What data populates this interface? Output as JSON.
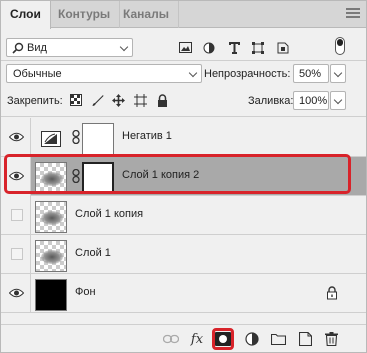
{
  "tabs": [
    {
      "label": "Слои",
      "active": true
    },
    {
      "label": "Контуры",
      "active": false
    },
    {
      "label": "Каналы",
      "active": false
    }
  ],
  "filter": {
    "kind_label": "Вид",
    "icons": [
      "pixel-filter-icon",
      "adjustment-filter-icon",
      "type-filter-icon",
      "shape-filter-icon",
      "smart-object-filter-icon"
    ]
  },
  "blend": {
    "mode": "Обычные",
    "opacity_label": "Непрозрачность:",
    "opacity_value": "50%",
    "lock_label": "Закрепить:",
    "fill_label": "Заливка:",
    "fill_value": "100%"
  },
  "layers": [
    {
      "name": "Негатив 1",
      "visible": true,
      "selected": false,
      "type": "adjustment"
    },
    {
      "name": "Слой 1 копия 2",
      "visible": true,
      "selected": true,
      "type": "masked"
    },
    {
      "name": "Слой 1 копия",
      "visible": false,
      "selected": false,
      "type": "pixel"
    },
    {
      "name": "Слой 1",
      "visible": false,
      "selected": false,
      "type": "pixel"
    },
    {
      "name": "Фон",
      "visible": true,
      "selected": false,
      "type": "background",
      "locked": true
    }
  ],
  "bottom_icons": [
    "link-icon",
    "fx-icon",
    "add-mask-icon",
    "adjustment-layer-icon",
    "group-folder-icon",
    "new-layer-icon",
    "delete-icon"
  ],
  "bottom": {
    "fx_label": "fx"
  },
  "colors": {
    "highlight": "#d8232a",
    "selected_row": "#a9a9a9"
  }
}
